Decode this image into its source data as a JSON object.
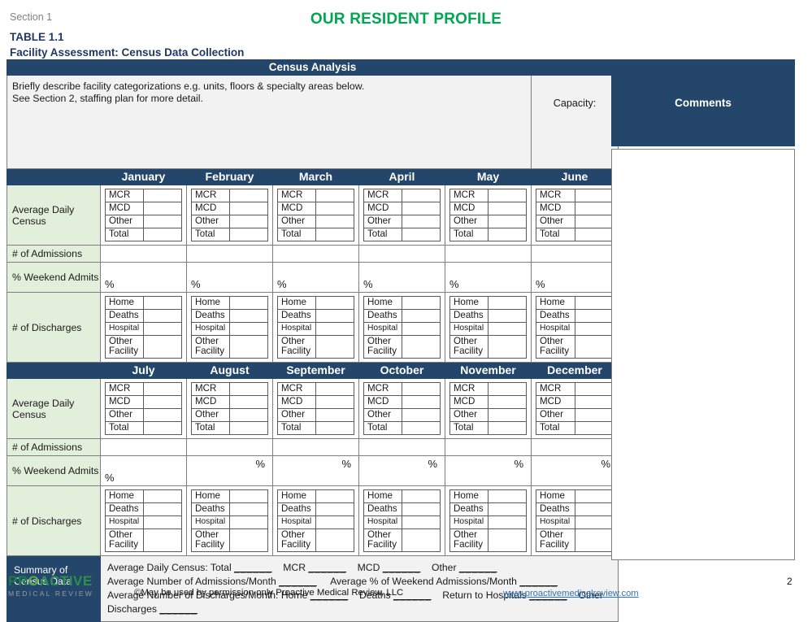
{
  "header": {
    "section_label": "Section 1",
    "doc_title": "OUR RESIDENT PROFILE",
    "table_number": "TABLE 1.1",
    "facility_assessment": "Facility Assessment:  Census Data Collection",
    "title_color": "#00a651",
    "navy_color": "#24466b",
    "green_row_color": "#e2efda"
  },
  "census_analysis": {
    "banner": "Census Analysis",
    "describe_line1": "Briefly describe facility categorizations e.g. units, floors & specialty areas below.",
    "describe_line2": "See Section 2, staffing plan for more detail.",
    "capacity_label": "Capacity:"
  },
  "comments": {
    "title": "Comments",
    "value": ""
  },
  "row_labels": {
    "average_daily_census": "Average Daily Census",
    "admissions": "# of Admissions",
    "weekend_admits": "% Weekend Admits",
    "discharges": "# of Discharges",
    "summary": "Summary of Census Data"
  },
  "census_sub_rows": [
    "MCR",
    "MCD",
    "Other",
    "Total"
  ],
  "discharge_sub_rows": [
    "Home",
    "Deaths",
    "Hospital",
    "Other Facility"
  ],
  "percent_symbol": "%",
  "half1": {
    "months": [
      "January",
      "February",
      "March",
      "April",
      "May",
      "June"
    ],
    "percent_align": [
      "bl",
      "bl",
      "bl",
      "bl",
      "bl",
      "bl"
    ]
  },
  "half2": {
    "months": [
      "July",
      "August",
      "September",
      "October",
      "November",
      "December"
    ],
    "percent_align": [
      "bl",
      "tr",
      "tr",
      "tr",
      "tr",
      "tr"
    ]
  },
  "summary": {
    "line1_parts": [
      "Average Daily Census: Total ",
      "MCR ",
      "MCD ",
      "Other "
    ],
    "line2_parts": [
      "Average Number of Admissions/Month ",
      "Average % of Weekend Admissions/Month "
    ],
    "line3_parts": [
      "Average Number of Discharges/Month: Home ",
      "Deaths ",
      "Return to Hospitals ",
      "Other Discharges "
    ],
    "blank": "______"
  },
  "footer": {
    "logo_p": "PR",
    "logo_o": "O",
    "logo_rest": "ACTIVE",
    "logo_sub": "MEDICAL REVIEW",
    "copyright": "©May be used by permission only Proactive Medical Review, LLC",
    "website": "www.proactivemedicalreview.com",
    "page_number": "2",
    "link_color": "#2e74b5"
  }
}
